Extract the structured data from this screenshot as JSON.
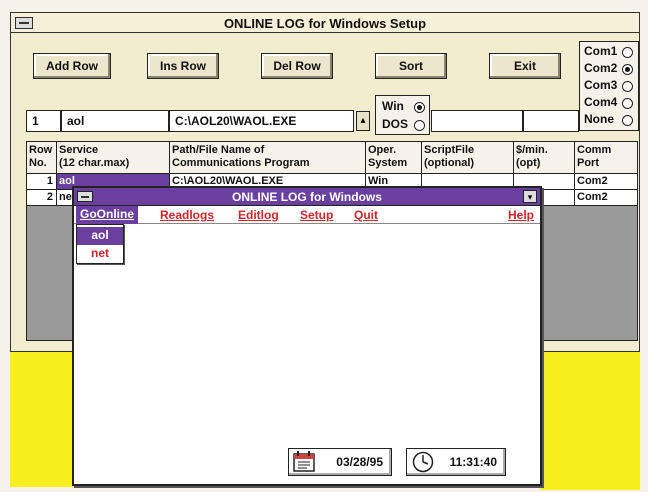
{
  "setup": {
    "title": "ONLINE LOG for Windows Setup",
    "buttons": {
      "add_row": "Add Row",
      "ins_row": "Ins Row",
      "del_row": "Del Row",
      "sort": "Sort",
      "exit": "Exit"
    },
    "com_ports": [
      {
        "label": "Com1",
        "selected": false
      },
      {
        "label": "Com2",
        "selected": true
      },
      {
        "label": "Com3",
        "selected": false
      },
      {
        "label": "Com4",
        "selected": false
      },
      {
        "label": "None",
        "selected": false
      }
    ],
    "os_options": [
      {
        "label": "Win",
        "selected": true
      },
      {
        "label": "DOS",
        "selected": false
      }
    ],
    "edit_row": {
      "row_no": "1",
      "service": "aol",
      "path": "C:\\AOL20\\WAOL.EXE"
    },
    "columns": [
      "Row No.",
      "Service (12 char.max)",
      "Path/File Name of Communications Program",
      "Oper. System",
      "ScriptFile (optional)",
      "$/min. (opt)",
      "Comm Port"
    ],
    "col_labels": {
      "row1": "Row",
      "row2": "No.",
      "svc1": "Service",
      "svc2": "(12 char.max)",
      "path1": "Path/File Name of",
      "path2": "Communications Program",
      "os1": "Oper.",
      "os2": "System",
      "script1": "ScriptFile",
      "script2": "(optional)",
      "rate1": "$/min.",
      "rate2": "(opt)",
      "port1": "Comm",
      "port2": "Port"
    },
    "rows": [
      {
        "no": "1",
        "service": "aol",
        "path": "C:\\AOL20\\WAOL.EXE",
        "os": "Win",
        "script": "",
        "rate": "",
        "port": "Com2"
      },
      {
        "no": "2",
        "service": "ne",
        "path": "",
        "os": "",
        "script": "",
        "rate": "",
        "port": "Com2"
      }
    ]
  },
  "main": {
    "title": "ONLINE LOG for Windows",
    "menu": [
      "GoOnline",
      "Readlogs",
      "Editlog",
      "Setup",
      "Quit",
      "Help"
    ],
    "dropdown": [
      "aol",
      "net"
    ],
    "date": "03/28/95",
    "time": "11:31:40"
  },
  "colors": {
    "title_bar": "#6b3fa0",
    "menu_text": "#d0262a",
    "background_accent": "#f7ef1e"
  },
  "icons": [
    "calendar-icon",
    "clock-icon"
  ]
}
